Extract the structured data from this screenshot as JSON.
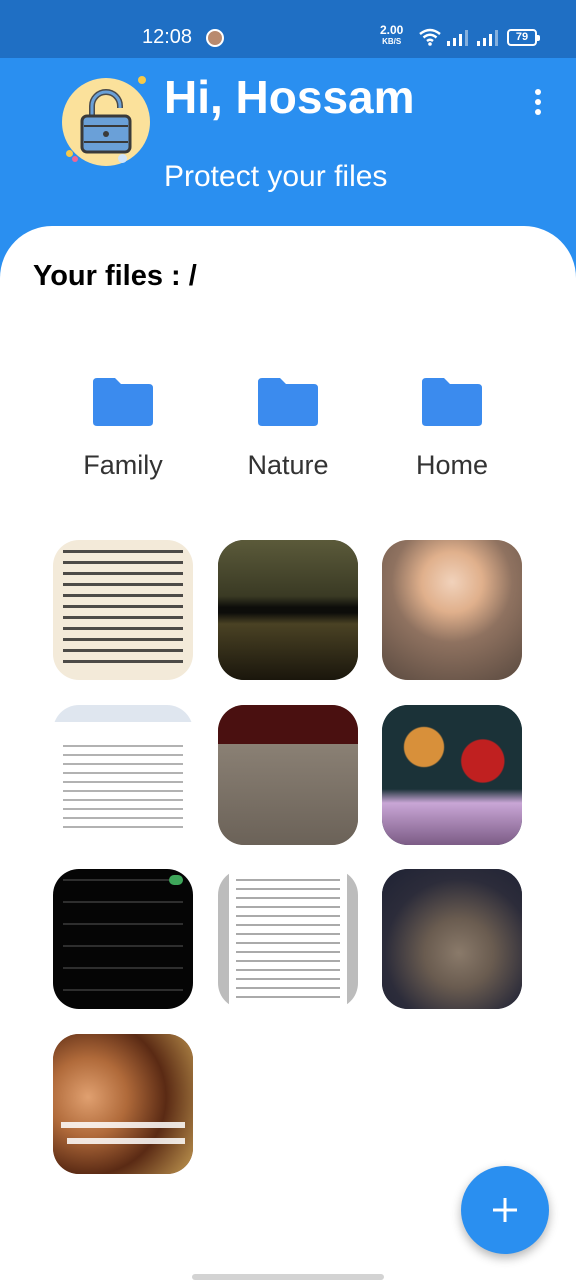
{
  "status_bar": {
    "time": "12:08",
    "speed_value": "2.00",
    "speed_unit": "KB/S",
    "battery": "79"
  },
  "header": {
    "greeting": "Hi, Hossam",
    "subtitle": "Protect your files"
  },
  "files": {
    "path_title": "Your files : /",
    "folders": [
      {
        "label": "Family"
      },
      {
        "label": "Nature"
      },
      {
        "label": "Home"
      }
    ],
    "thumbnails": [
      {
        "kind": "document-scan"
      },
      {
        "kind": "dark-movie-scene"
      },
      {
        "kind": "portrait"
      },
      {
        "kind": "social-post-screenshot"
      },
      {
        "kind": "floor-tiles"
      },
      {
        "kind": "man-with-food"
      },
      {
        "kind": "settings-screenshot"
      },
      {
        "kind": "text-page"
      },
      {
        "kind": "cat"
      },
      {
        "kind": "movie-subtitle"
      }
    ]
  },
  "colors": {
    "primary": "#2a8ff0",
    "status_bar": "#1f6fc4",
    "folder": "#3b8bee"
  },
  "icons": {
    "app_logo": "unlocked-padlock-icon",
    "menu": "more-vertical-icon",
    "fab": "plus-icon",
    "folder": "folder-icon"
  }
}
